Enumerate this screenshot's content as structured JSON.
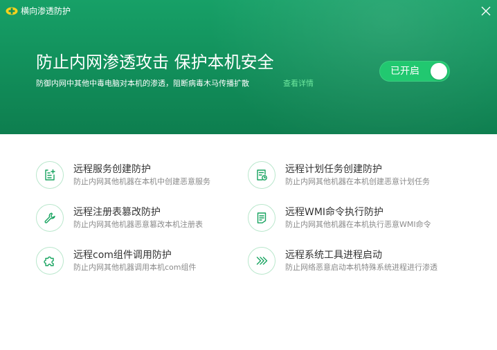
{
  "window": {
    "title": "横向渗透防护",
    "brand_color": "#12915c",
    "accent_color": "#21c870"
  },
  "header": {
    "headline": "防止内网渗透攻击 保护本机安全",
    "subline": "防御内网中其他中毒电脑对本机的渗透，阻断病毒木马传播扩散",
    "details_link": "查看详情",
    "toggle_label": "已开启",
    "toggle_on": true
  },
  "features": [
    {
      "title": "远程服务创建防护",
      "desc": "防止内网其他机器在本机中创建恶意服务",
      "icon": "service-add-icon"
    },
    {
      "title": "远程计划任务创建防护",
      "desc": "防止内网其他机器在本机创建恶意计划任务",
      "icon": "scheduled-task-icon"
    },
    {
      "title": "远程注册表篡改防护",
      "desc": "防止内网其他机器恶意篡改本机注册表",
      "icon": "wrench-icon"
    },
    {
      "title": "远程WMI命令执行防护",
      "desc": "防止内网其他机器在本机执行恶意WMI命令",
      "icon": "document-icon"
    },
    {
      "title": "远程com组件调用防护",
      "desc": "防止内网其他机器调用本机com组件",
      "icon": "puzzle-icon"
    },
    {
      "title": "远程系统工具进程启动",
      "desc": "防止网络恶意启动本机特殊系统进程进行渗透",
      "icon": "chevrons-right-icon"
    }
  ]
}
